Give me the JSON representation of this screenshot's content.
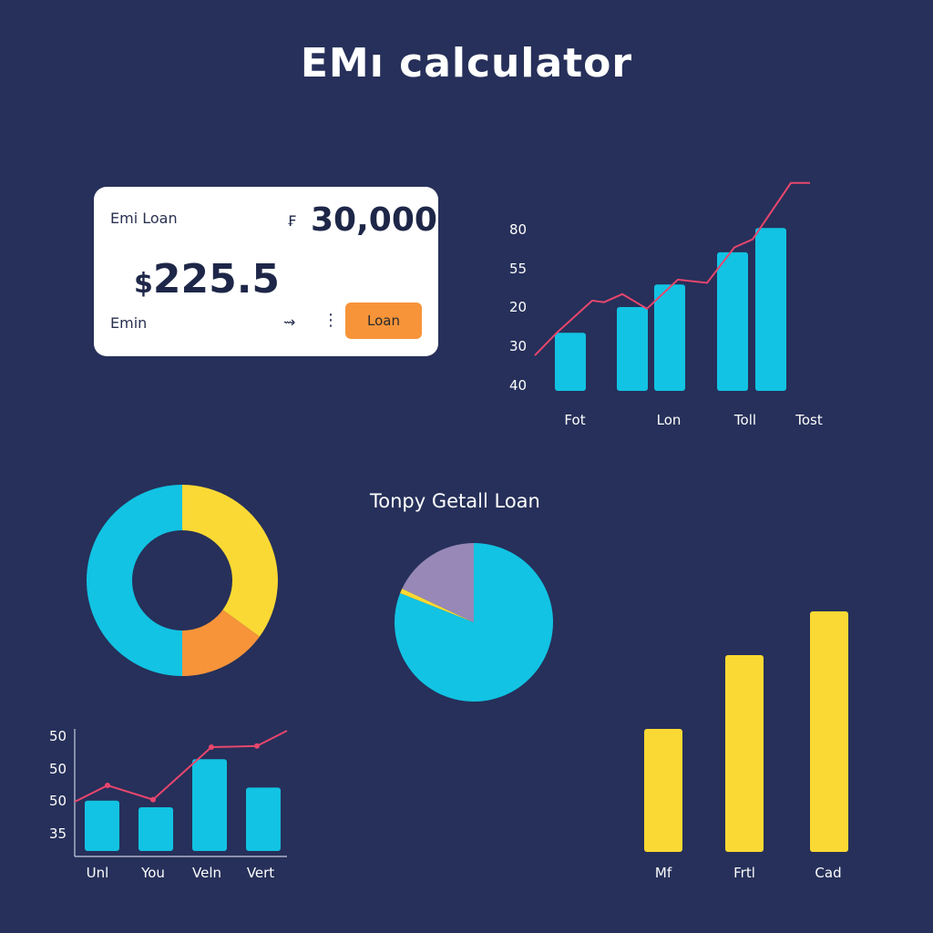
{
  "page": {
    "title": "EMı calculator"
  },
  "calculator": {
    "loan_label": "Emi Loan",
    "currency_symbol": "₣",
    "loan_amount": "30,000",
    "emi_currency": "$",
    "emi_value": "225.5",
    "emi_label": "Emin",
    "arrow_glyph": "⇝",
    "more_glyph": "⋮",
    "loan_button": "Loan"
  },
  "colors": {
    "background": "#26305a",
    "bar_cyan": "#12c3e3",
    "bar_yellow": "#fbd934",
    "line_red": "#e8466d",
    "accent_orange": "#f7943a",
    "slice_purple": "#9788b8"
  },
  "chart_data": [
    {
      "type": "bar",
      "title": "",
      "yticks": [
        "80",
        "55",
        "20",
        "30",
        "40"
      ],
      "xticks": [
        "Fot",
        "Lon",
        "Toll",
        "Tost"
      ],
      "bars": [
        36,
        52,
        66,
        86,
        101
      ],
      "line": [
        22,
        36,
        56,
        55,
        60,
        51,
        69,
        67,
        89,
        94,
        129,
        129
      ],
      "ylim": [
        0,
        130
      ]
    },
    {
      "type": "pie",
      "variant": "donut",
      "slices": [
        {
          "label": "",
          "value": 50,
          "color": "#fbd934",
          "start": 0,
          "end": 0.35
        },
        {
          "label": "",
          "value": 50,
          "color": "#f7943a",
          "start": 0.35,
          "end": 0.5
        },
        {
          "label": "",
          "value": 50,
          "color": "#12c3e3",
          "start": 0.5,
          "end": 1
        }
      ]
    },
    {
      "type": "pie",
      "title": "Tonpy Getall Loan",
      "slices": [
        {
          "label": "",
          "value": 81,
          "color": "#12c3e3",
          "start": 0,
          "end": 0.81
        },
        {
          "label": "",
          "value": 1,
          "color": "#fbd934",
          "start": 0.81,
          "end": 0.82
        },
        {
          "label": "",
          "value": 18,
          "color": "#9788b8",
          "start": 0.82,
          "end": 1
        }
      ]
    },
    {
      "type": "bar",
      "title": "",
      "yticks": [
        "50",
        "50",
        "50",
        "35"
      ],
      "xticks": [
        "Unl",
        "You",
        "Veln",
        "Vert"
      ],
      "bars": [
        46,
        40,
        84,
        58
      ],
      "line": [
        45,
        60,
        47,
        95,
        96,
        110
      ],
      "ylim": [
        0,
        140
      ]
    },
    {
      "type": "bar",
      "title": "",
      "xticks": [
        "Mf",
        "Frtl",
        "Cad"
      ],
      "values": [
        135,
        216,
        264
      ],
      "ylim": [
        0,
        300
      ]
    }
  ]
}
